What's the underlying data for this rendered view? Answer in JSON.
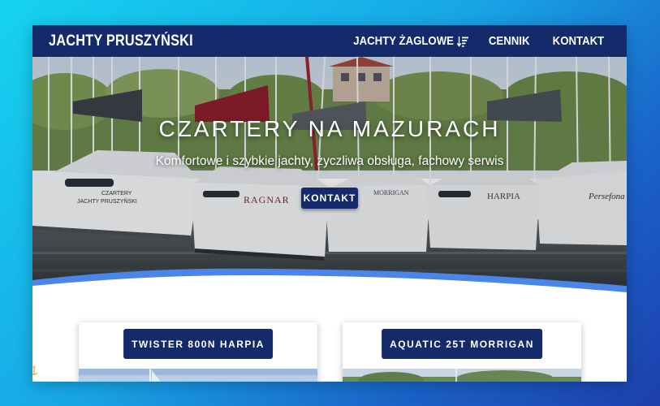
{
  "navbar": {
    "brand": "JACHTY PRUSZYŃSKI",
    "items": [
      {
        "label": "JACHTY ŻAGLOWE",
        "icon": "sort-descending-icon"
      },
      {
        "label": "CENNIK"
      },
      {
        "label": "KONTAKT"
      }
    ]
  },
  "hero": {
    "title": "CZARTERY NA MAZURACH",
    "subtitle": "Komfortowe i szybkie jachty, życzliwa obsługa, fachowy serwis",
    "button": "KONTAKT",
    "boat_lettering": [
      "CZARTERY",
      "JACHTY PRUSZYŃSKI",
      "RAGNAR",
      "HARPIA",
      "Persefona",
      "MORRIGAN"
    ]
  },
  "cards": [
    {
      "button": "TWISTER 800N HARPIA"
    },
    {
      "button": "AQUATIC 25T MORRIGAN"
    }
  ],
  "colors": {
    "navy": "#142a6b",
    "wave": "#4a86e8",
    "background_gradient": [
      "#16d3f0",
      "#1d3fae"
    ]
  }
}
